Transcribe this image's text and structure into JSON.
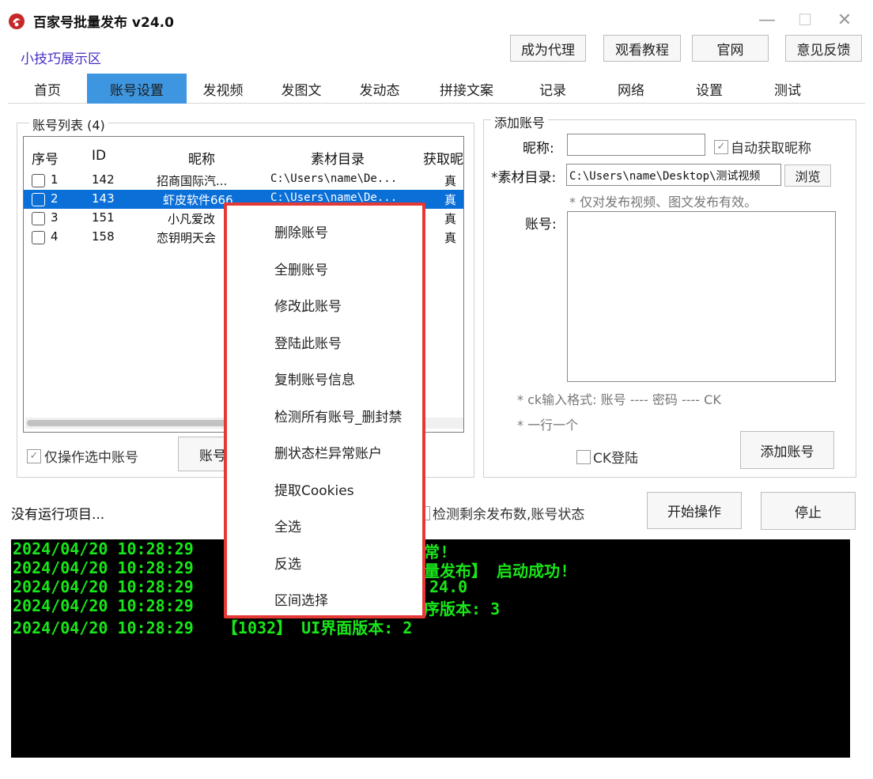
{
  "window": {
    "title": "百家号批量发布  v24.0",
    "icon": "app-logo-icon",
    "minimize_icon": "minimize-icon",
    "maximize_icon": "maximize-icon",
    "close_icon": "close-icon",
    "minimize_glyph": "—",
    "maximize_glyph": "☐",
    "close_glyph": "✕"
  },
  "header": {
    "demo_link": "小技巧展示区",
    "buttons": [
      "成为代理",
      "观看教程",
      "官网",
      "意见反馈"
    ]
  },
  "tabs": {
    "active": "账号设置",
    "items": [
      "首页",
      "账号设置",
      "发视频",
      "发图文",
      "发动态",
      "拼接文案",
      "记录",
      "网络",
      "设置",
      "测试"
    ]
  },
  "account_list": {
    "group_title": "账号列表  (4)",
    "columns": [
      "序号",
      "ID",
      "昵称",
      "素材目录",
      "获取昵"
    ],
    "rows": [
      {
        "no": "1",
        "id": "142",
        "nickname": "招商国际汽...",
        "dir": "C:\\Users\\name\\De...",
        "fetch": "真",
        "selected": false
      },
      {
        "no": "2",
        "id": "143",
        "nickname": "虾皮软件666",
        "dir": "C:\\Users\\name\\De...",
        "fetch": "真",
        "selected": true
      },
      {
        "no": "3",
        "id": "151",
        "nickname": "小凡爱改",
        "dir": "",
        "fetch": "真",
        "selected": false
      },
      {
        "no": "4",
        "id": "158",
        "nickname": "恋钥明天会",
        "dir": "",
        "fetch": "真",
        "selected": false
      }
    ],
    "only_selected_label": "仅操作选中账号",
    "only_selected_checked": true,
    "account_button_partial": "账号"
  },
  "add_account": {
    "group_title": "添加账号",
    "nickname_label": "昵称:",
    "nickname_value": "",
    "auto_fetch_label": "自动获取昵称",
    "auto_fetch_checked": true,
    "dir_label": "*素材目录:",
    "dir_value": "C:\\Users\\name\\Desktop\\测试视频",
    "browse_button": "浏览",
    "dir_note": "* 仅对发布视频、图文发布有效。",
    "account_label": "账号:",
    "account_value": "",
    "ck_format_note": "* ck输入格式: 账号 ---- 密码 ---- CK",
    "one_per_line_note": "* 一行一个",
    "ck_login_label": "CK登陆",
    "ck_login_checked": false,
    "add_button": "添加账号"
  },
  "status": {
    "text": "没有运行项目...",
    "detect_label": "检测剩余发布数,账号状态",
    "start_button": "开始操作",
    "stop_button": "停止"
  },
  "console": {
    "color": "#19e619",
    "lines": [
      "2024/04/20 10:28:29",
      "2024/04/20 10:28:29",
      "2024/04/20 10:28:29",
      "2024/04/20 10:28:29",
      "2024/04/20 10:28:29   【1032】 UI界面版本: 2"
    ],
    "visible_tails": [
      "常!",
      "量发布】 启动成功!",
      "24.0",
      "序版本: 3"
    ]
  },
  "context_menu": {
    "border_color": "#e53935",
    "items": [
      "删除账号",
      "全删账号",
      "修改此账号",
      "登陆此账号",
      "复制账号信息",
      "检测所有账号_删封禁",
      "删状态栏异常账户",
      "提取Cookies",
      "全选",
      "反选",
      "区间选择"
    ]
  },
  "colors": {
    "tab_active": "#3f96e0",
    "row_selected": "#0b6fd8",
    "link": "#4a2fc4"
  }
}
